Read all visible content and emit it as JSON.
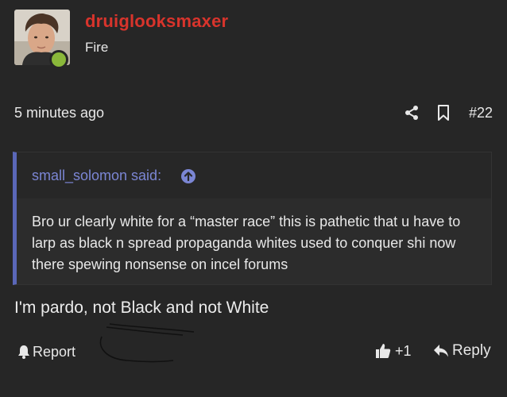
{
  "post": {
    "author": "druiglooksmaxer",
    "user_title": "Fire",
    "timestamp": "5 minutes ago",
    "post_number": "#22",
    "message": "I'm pardo, not Black and not White"
  },
  "quote": {
    "author_label": "small_solomon said:",
    "body": "Bro ur clearly white for a “master race” this is pathetic that u have to larp as black n spread propaganda whites used to conquer shi now there spewing nonsense on incel forums"
  },
  "actions": {
    "report_label": "Report",
    "like_count": "+1",
    "reply_label": "Reply"
  },
  "icons": {
    "share": "share-icon",
    "bookmark": "bookmark-icon",
    "quote_jump": "arrow-up-circle-icon",
    "report": "bell-icon",
    "like": "thumbs-up-icon",
    "reply": "reply-arrow-icon"
  },
  "colors": {
    "background": "#262626",
    "username": "#d8342c",
    "quote_author": "#7b86d4",
    "quote_border": "#5a67b8",
    "online_status": "#8ab83a"
  }
}
